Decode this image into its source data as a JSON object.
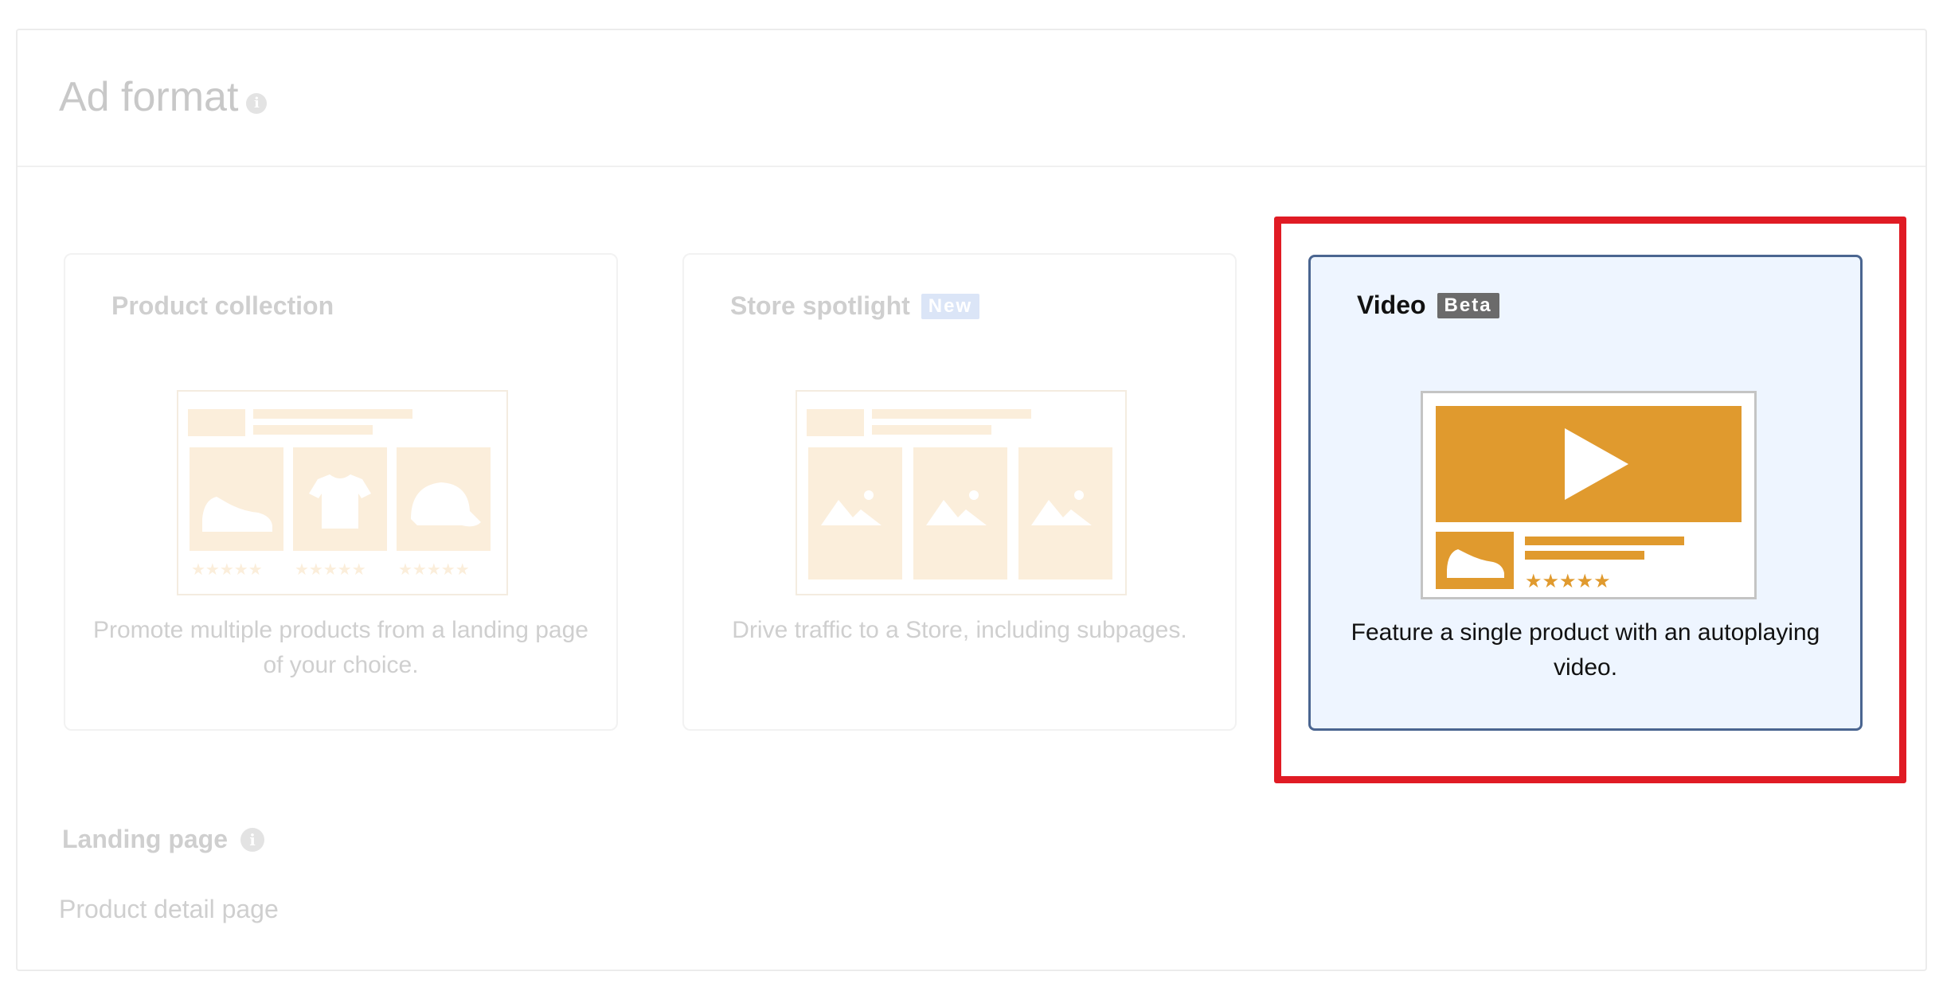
{
  "section": {
    "title": "Ad format"
  },
  "formats": [
    {
      "title": "Product collection",
      "badge": "",
      "description": "Promote multiple products from a landing page of your choice."
    },
    {
      "title": "Store spotlight",
      "badge": "New",
      "description": "Drive traffic to a Store, including subpages."
    },
    {
      "title": "Video",
      "badge": "Beta",
      "description": "Feature a single product with an autoplaying video.",
      "selected": true
    }
  ],
  "landing_page": {
    "label": "Landing page",
    "value": "Product detail page"
  },
  "colors": {
    "accent_orange": "#e09a2e",
    "faded_orange": "#fbeedb",
    "selected_border": "#4a6590",
    "selected_bg": "#eef5ff",
    "highlight_red": "#e01b24"
  },
  "icons": [
    "info-icon",
    "shoe-icon",
    "tshirt-icon",
    "cap-icon",
    "image-placeholder-icon",
    "play-icon",
    "star-icon"
  ]
}
